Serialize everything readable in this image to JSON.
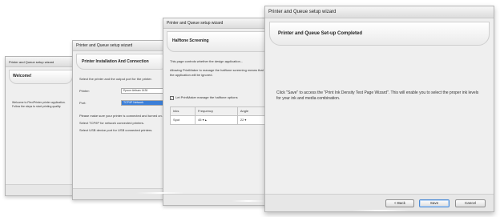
{
  "window_title": "Printer and Queue setup wizard",
  "dialogs": {
    "welcome": {
      "title": "Printer and Queue setup wizard",
      "banner": "Welcome!",
      "text": "Welcome to FlexiPrinter printer application. Follow the steps to start printing quality."
    },
    "installation": {
      "title": "Printer and Queue setup wizard",
      "banner": "Printer Installation And Connection",
      "intro": "Select the printer and the output port for the printer.",
      "printer_label": "Printer:",
      "printer_value": "Epson Artisan 1430",
      "port_label": "Port:",
      "port_value": "TCP/IP Network",
      "note1": "Please make sure your printer is connected and turned on.",
      "note2": "Select TCP/IP for network connected printers.",
      "note3": "Select USB device port for USB connected printers."
    },
    "halftone": {
      "title": "Printer and Queue setup wizard",
      "banner": "Halftone Screening",
      "text1": "This page controls whether the design application...",
      "text2": "Allowing PrintMaker to manage the halftone screening means that the application will be ignored.",
      "checkbox_label": "Let PrintMaker manage the halftone options",
      "table": {
        "headers": [
          "Inks",
          "Frequency",
          "Angle"
        ],
        "rows": [
          [
            "Spot",
            "45 ▾ ▴",
            "22 ▾"
          ]
        ]
      }
    },
    "completed": {
      "title": "Printer and Queue setup wizard",
      "banner": "Printer and Queue Set-up Completed",
      "message": "Click \"Save\" to access the \"Print Ink Density Test Page Wizard\". This will enable you to select the proper ink levels for your ink and media combination.",
      "buttons": {
        "back": "< Back",
        "save": "Save",
        "cancel": "Cancel"
      }
    }
  }
}
